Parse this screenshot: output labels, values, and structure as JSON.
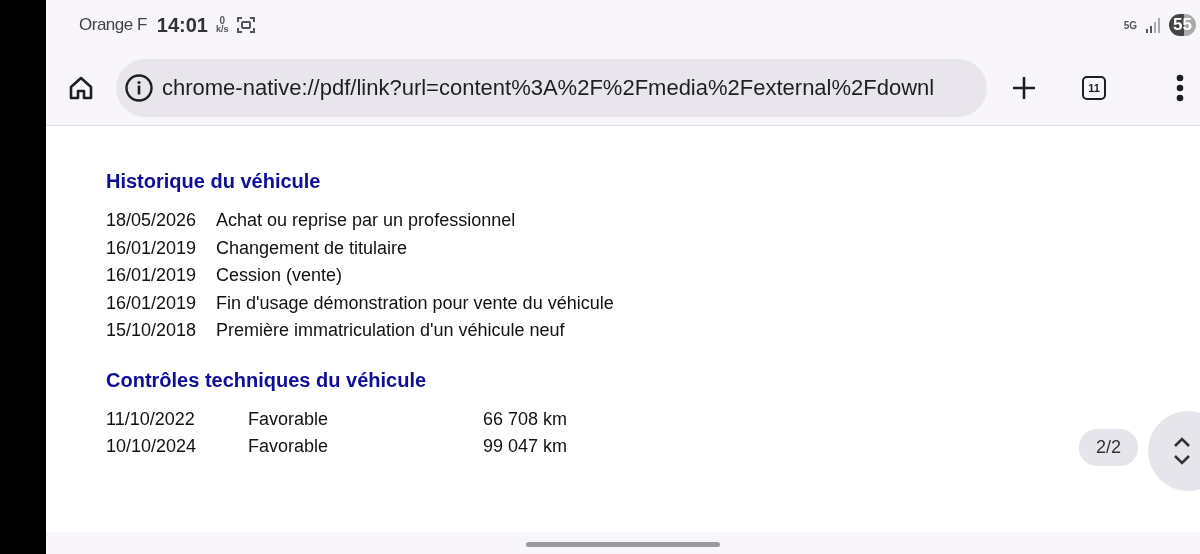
{
  "status_bar": {
    "carrier": "Orange F",
    "time": "14:01",
    "net_speed": "0",
    "net_unit": "k/s",
    "network": "5G",
    "battery": "55"
  },
  "toolbar": {
    "url": "chrome-native://pdf/link?url=content%3A%2F%2Fmedia%2Fexternal%2Fdownl",
    "tab_count": "11"
  },
  "sections": [
    {
      "title": "Historique du véhicule",
      "kind": "history",
      "rows": [
        {
          "cells": [
            "18/05/2026",
            "Achat ou reprise par un professionnel"
          ]
        },
        {
          "cells": [
            "16/01/2019",
            "Changement de titulaire"
          ]
        },
        {
          "cells": [
            "16/01/2019",
            "Cession (vente)"
          ]
        },
        {
          "cells": [
            "16/01/2019",
            "Fin d'usage démonstration pour vente du véhicule"
          ]
        },
        {
          "cells": [
            "15/10/2018",
            "Première immatriculation d'un véhicule neuf"
          ]
        }
      ]
    },
    {
      "title": "Contrôles techniques du véhicule",
      "kind": "inspections",
      "rows": [
        {
          "cells": [
            "11/10/2022",
            "Favorable",
            "66 708 km"
          ]
        },
        {
          "cells": [
            "10/10/2024",
            "Favorable",
            "99 047 km"
          ]
        }
      ]
    }
  ],
  "page_indicator": "2/2"
}
